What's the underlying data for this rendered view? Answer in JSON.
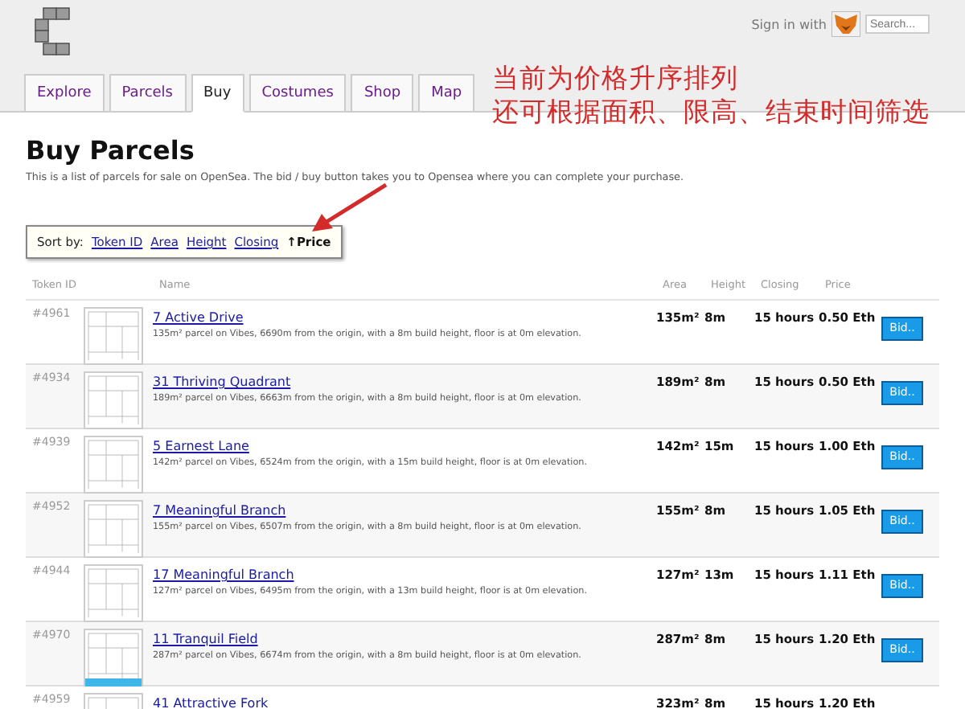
{
  "header": {
    "sign_in_label": "Sign in with",
    "search": {
      "placeholder": "Search..."
    }
  },
  "tabs": [
    {
      "label": "Explore",
      "selected": false
    },
    {
      "label": "Parcels",
      "selected": false
    },
    {
      "label": "Buy",
      "selected": true
    },
    {
      "label": "Costumes",
      "selected": false
    },
    {
      "label": "Shop",
      "selected": false
    },
    {
      "label": "Map",
      "selected": false
    }
  ],
  "annotation": {
    "lines": [
      "当前为价格升序排列",
      "还可根据面积、限高、结束时间筛选"
    ]
  },
  "page": {
    "title": "Buy Parcels",
    "intro": "This is a list of parcels for sale on OpenSea. The bid / buy button takes you to Opensea where you can complete your purchase."
  },
  "sort": {
    "label": "Sort by:",
    "options": [
      {
        "label": "Token ID",
        "selected": false
      },
      {
        "label": "Area",
        "selected": false
      },
      {
        "label": "Height",
        "selected": false
      },
      {
        "label": "Closing",
        "selected": false
      },
      {
        "label": "↑Price",
        "selected": true
      }
    ]
  },
  "table": {
    "columns": [
      "Token ID",
      "Name",
      "Area",
      "Height",
      "Closing",
      "Price"
    ],
    "rows": [
      {
        "token": "#4961",
        "name": "7 Active Drive",
        "description": "135m² parcel on Vibes, 6690m from the origin, with a 8m build height, floor is at 0m elevation.",
        "area": "135m²",
        "height": "8m",
        "closing": "15 hours",
        "price": "0.50 Eth",
        "button": "Bid..",
        "thumbnail_bar": false
      },
      {
        "token": "#4934",
        "name": "31 Thriving Quadrant",
        "description": "189m² parcel on Vibes, 6663m from the origin, with a 8m build height, floor is at 0m elevation.",
        "area": "189m²",
        "height": "8m",
        "closing": "15 hours",
        "price": "0.50 Eth",
        "button": "Bid..",
        "thumbnail_bar": false
      },
      {
        "token": "#4939",
        "name": "5 Earnest Lane",
        "description": "142m² parcel on Vibes, 6524m from the origin, with a 15m build height, floor is at 0m elevation.",
        "area": "142m²",
        "height": "15m",
        "closing": "15 hours",
        "price": "1.00 Eth",
        "button": "Bid..",
        "thumbnail_bar": false
      },
      {
        "token": "#4952",
        "name": "7 Meaningful Branch",
        "description": "155m² parcel on Vibes, 6507m from the origin, with a 8m build height, floor is at 0m elevation.",
        "area": "155m²",
        "height": "8m",
        "closing": "15 hours",
        "price": "1.05 Eth",
        "button": "Bid..",
        "thumbnail_bar": false
      },
      {
        "token": "#4944",
        "name": "17 Meaningful Branch",
        "description": "127m² parcel on Vibes, 6495m from the origin, with a 13m build height, floor is at 0m elevation.",
        "area": "127m²",
        "height": "13m",
        "closing": "15 hours",
        "price": "1.11 Eth",
        "button": "Bid..",
        "thumbnail_bar": false
      },
      {
        "token": "#4970",
        "name": "11 Tranquil Field",
        "description": "287m² parcel on Vibes, 6674m from the origin, with a 8m build height, floor is at 0m elevation.",
        "area": "287m²",
        "height": "8m",
        "closing": "15 hours",
        "price": "1.20 Eth",
        "button": "Bid..",
        "thumbnail_bar": true
      },
      {
        "token": "#4959",
        "name": "41 Attractive Fork",
        "area": "323m²",
        "height": "8m",
        "closing": "15 hours",
        "price": "1.20 Eth"
      }
    ]
  }
}
